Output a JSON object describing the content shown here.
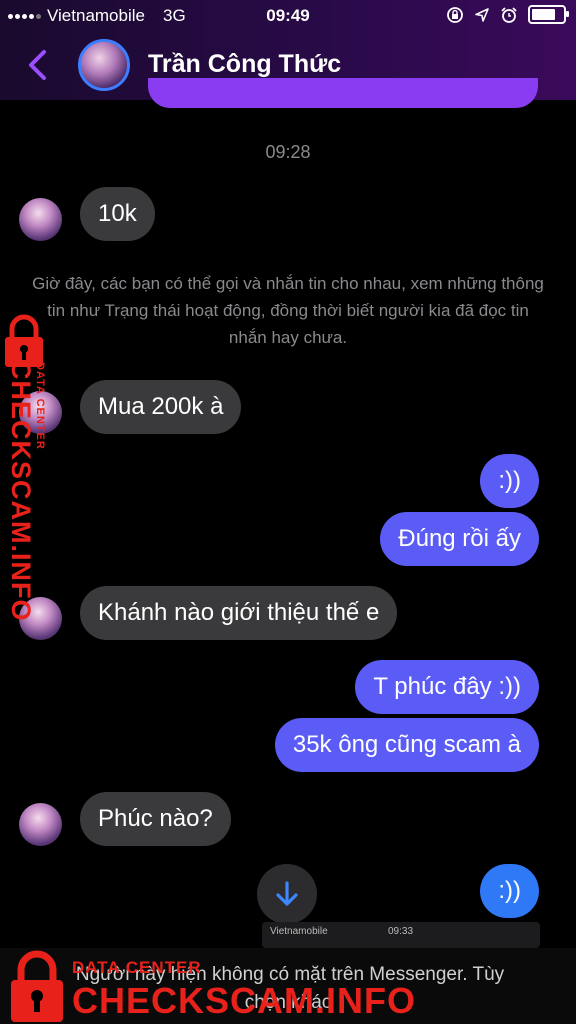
{
  "status_bar": {
    "carrier": "Vietnamobile",
    "network": "3G",
    "time": "09:49",
    "battery_level": 0.9
  },
  "header": {
    "contact_name": "Trần Công Thức"
  },
  "conversation": {
    "timestamp": "09:28",
    "notice": "Giờ đây, các bạn có thể gọi và nhắn tin cho nhau, xem những thông tin như Trạng thái hoạt động, đồng thời biết người kia đã đọc tin nhắn hay chưa.",
    "messages": [
      {
        "from": "them",
        "text": "10k"
      },
      {
        "from": "them",
        "text": "Mua 200k à"
      },
      {
        "from": "me",
        "text": ":))"
      },
      {
        "from": "me",
        "text": "Đúng rồi ấy"
      },
      {
        "from": "them",
        "text": "Khánh nào giới thiệu thế e"
      },
      {
        "from": "me",
        "text": "T phúc đây :))"
      },
      {
        "from": "me",
        "text": "35k ông cũng scam à"
      },
      {
        "from": "them",
        "text": "Phúc nào?"
      },
      {
        "from": "me",
        "text": ":))"
      }
    ]
  },
  "thumbnail": {
    "carrier": "Vietnamobile",
    "time": "09:33"
  },
  "footer": {
    "line1": "Người này hiện không có mặt trên Messenger. Tùy",
    "line2": "chọn khác"
  },
  "watermark": {
    "small": "DATA CENTER",
    "big": "CHECKSCAM.INFO",
    "color": "#e8221b"
  },
  "colors": {
    "incoming_bubble": "#3a3a3c",
    "outgoing_bubble": "#5b5cf6",
    "outgoing_bubble_last": "#2f78f6",
    "accent": "#8a3df0"
  }
}
